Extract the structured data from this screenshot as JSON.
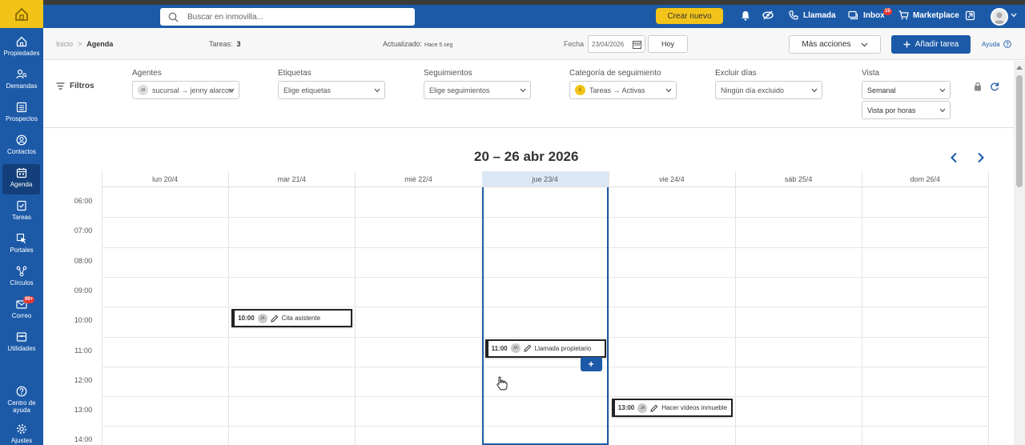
{
  "topbar": {
    "search_placeholder": "Buscar en inmovilla...",
    "crear_label": "Crear nuevo",
    "llamada_label": "Llamada",
    "inbox_label": "Inbox",
    "inbox_badge": "15",
    "marketplace_label": "Marketplace"
  },
  "sidebar": {
    "items": [
      {
        "label": "Propiedades",
        "icon": "home-icon"
      },
      {
        "label": "Demandas",
        "icon": "user-search-icon"
      },
      {
        "label": "Prospectos",
        "icon": "list-icon"
      },
      {
        "label": "Contactos",
        "icon": "contact-icon"
      },
      {
        "label": "Agenda",
        "icon": "calendar-icon"
      },
      {
        "label": "Tareas",
        "icon": "task-icon"
      },
      {
        "label": "Portales",
        "icon": "cursor-icon"
      },
      {
        "label": "Círculos",
        "icon": "network-icon"
      },
      {
        "label": "Correo",
        "icon": "mail-icon",
        "badge": "99+"
      },
      {
        "label": "Utilidades",
        "icon": "toolbox-icon"
      },
      {
        "label": "Centro de ayuda",
        "icon": "help-icon"
      },
      {
        "label": "Ajustes",
        "icon": "gear-icon"
      }
    ]
  },
  "header": {
    "breadcrumb_root": "Inicio",
    "breadcrumb_sep": ">",
    "breadcrumb_current": "Agenda",
    "tareas_label": "Tareas:",
    "tareas_count": "3",
    "actualizado_label": "Actualizado:",
    "actualizado_value": "Hace 5 seg",
    "fecha_label": "Fecha",
    "fecha_value": "23/04/2026",
    "hoy_label": "Hoy",
    "mas_acciones_label": "Más acciones",
    "anadir_label": "Añadir tarea",
    "ayuda_label": "Ayuda"
  },
  "filters": {
    "title": "Filtros",
    "agentes_label": "Agentes",
    "agentes_avatar": "JA",
    "agentes_value": "sucursal → jenny alarcon",
    "etiquetas_label": "Etiquetas",
    "etiquetas_value": "Elige etiquetas",
    "seguimientos_label": "Seguimientos",
    "seguimientos_value": "Elige seguimientos",
    "categoria_label": "Categoría de seguimiento",
    "categoria_value": "Tareas → Activas",
    "excluir_label": "Excluir días",
    "excluir_value": "Ningún día excluido",
    "vista_label": "Vista",
    "vista_value": "Semanal",
    "vista2_value": "Vista por horas"
  },
  "calendar": {
    "title": "20 – 26 abr 2026",
    "days": [
      "lun 20/4",
      "mar 21/4",
      "mié 22/4",
      "jue 23/4",
      "vie 24/4",
      "sáb 25/4",
      "dom 26/4"
    ],
    "today_index": 3,
    "hours": [
      "06:00",
      "07:00",
      "08:00",
      "09:00",
      "10:00",
      "11:00",
      "12:00",
      "13:00",
      "14:00"
    ],
    "events": [
      {
        "time": "10:00",
        "avatar": "JA",
        "title": "Cita asistente",
        "day_index": 1
      },
      {
        "time": "11:00",
        "avatar": "JA",
        "title": "Llamada propietario",
        "day_index": 3
      },
      {
        "time": "13:00",
        "avatar": "JA",
        "title": "Hacer vídeos inmueble",
        "day_index": 4
      }
    ],
    "add_button": "+"
  },
  "colors": {
    "primary": "#1c5aa8",
    "accent": "#f2c318"
  }
}
